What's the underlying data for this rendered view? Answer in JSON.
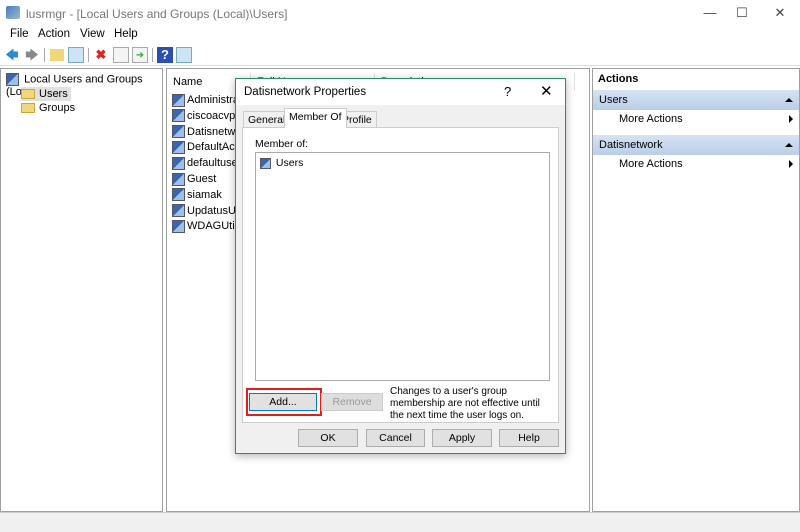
{
  "window": {
    "title": "lusrmgr - [Local Users and Groups (Local)\\Users]",
    "controls": [
      "minimize",
      "maximize",
      "close"
    ]
  },
  "menu": [
    "File",
    "Action",
    "View",
    "Help"
  ],
  "toolbar": [
    "back-icon",
    "forward-icon",
    "up-folder-icon",
    "show-hide-tree-icon",
    "delete-icon",
    "properties-icon",
    "export-icon",
    "help-icon",
    "show-hide-action-pane-icon"
  ],
  "tree": {
    "root": "Local Users and Groups (Local)",
    "items": [
      "Users",
      "Groups"
    ],
    "selected": "Users"
  },
  "list": {
    "columns": [
      "Name",
      "Full Name",
      "Description"
    ],
    "rows": [
      "Administrator",
      "ciscoacvpnuser",
      "Datisnetwork",
      "DefaultAccount",
      "defaultuser0",
      "Guest",
      "siamak",
      "UpdatusUser",
      "WDAGUtilityAccount"
    ]
  },
  "actions": {
    "title": "Actions",
    "sections": [
      {
        "header": "Users",
        "items": [
          "More Actions"
        ]
      },
      {
        "header": "Datisnetwork",
        "items": [
          "More Actions"
        ]
      }
    ]
  },
  "dialog": {
    "title": "Datisnetwork Properties",
    "help": "?",
    "tabs": [
      "General",
      "Member Of",
      "Profile"
    ],
    "active_tab": "Member Of",
    "member_of_label": "Member of:",
    "groups": [
      "Users"
    ],
    "add": "Add...",
    "remove": "Remove",
    "note": "Changes to a user's group membership are not effective until the next time the user logs on.",
    "ok": "OK",
    "cancel": "Cancel",
    "apply": "Apply",
    "help_btn": "Help"
  },
  "colors": {
    "highlight": "#e11d1d",
    "dialog_border": "#2f8a6b",
    "action_header": "#c5d7ec"
  }
}
